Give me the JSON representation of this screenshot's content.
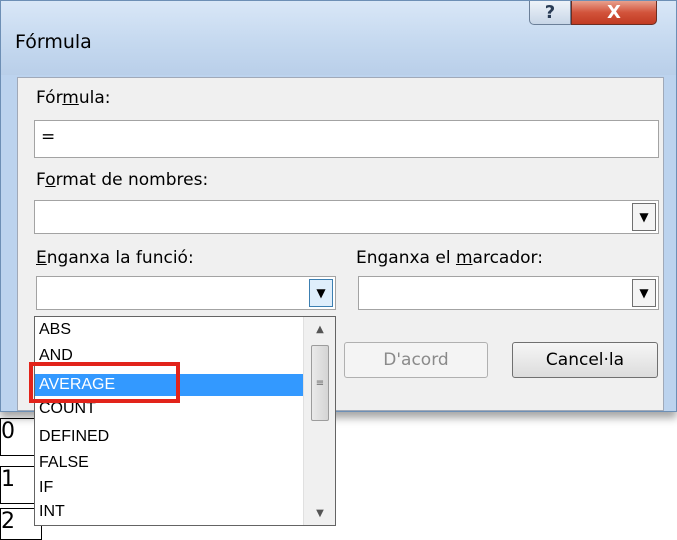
{
  "dialog": {
    "title": "Fórmula",
    "help_glyph": "?",
    "close_glyph": "X"
  },
  "formula": {
    "label_pre": "Fór",
    "label_mnemonic": "m",
    "label_post": "ula:",
    "value": "="
  },
  "number_format": {
    "label_pre": "F",
    "label_mnemonic": "o",
    "label_post": "rmat de nombres:",
    "value": ""
  },
  "paste_function": {
    "label_pre": "",
    "label_mnemonic": "E",
    "label_post": "nganxa la funció:",
    "value": "",
    "options": [
      "ABS",
      "AND",
      "AVERAGE",
      "COUNT",
      "DEFINED",
      "FALSE",
      "IF",
      "INT"
    ],
    "selected": "AVERAGE"
  },
  "paste_bookmark": {
    "label_pre": "Enganxa el ",
    "label_mnemonic": "m",
    "label_post": "arcador:",
    "value": ""
  },
  "buttons": {
    "ok_label": "D'acord",
    "cancel_label": "Cancel·la"
  },
  "background_doc": {
    "cells": [
      "0",
      "1",
      "2"
    ]
  },
  "colors": {
    "selection": "#3399ff",
    "highlight": "#e2231a",
    "close_button": "#c13b22"
  }
}
